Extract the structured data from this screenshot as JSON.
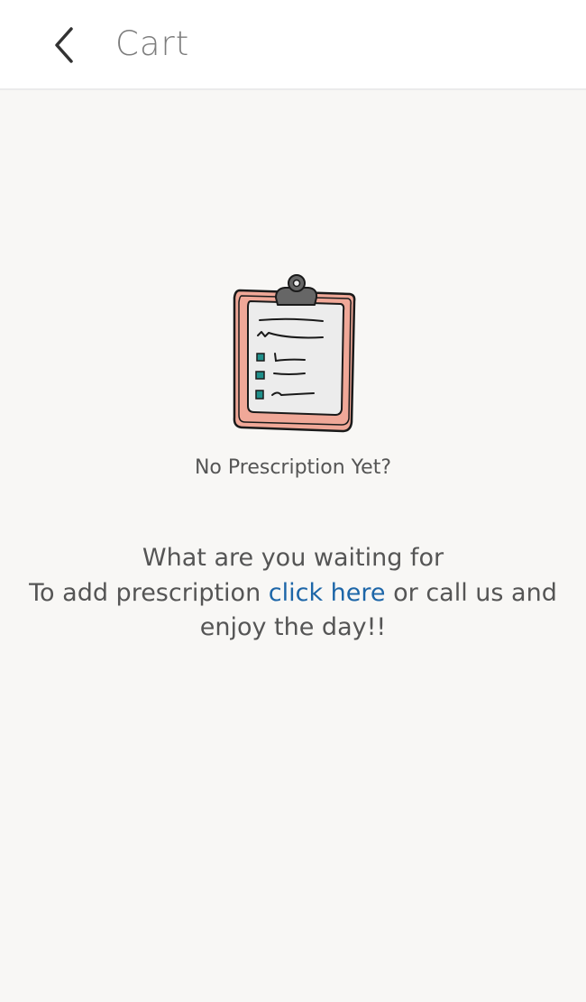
{
  "header": {
    "title": "Cart",
    "back_icon": "chevron-left-icon"
  },
  "empty_state": {
    "icon": "clipboard-icon",
    "caption": "No Prescription Yet?",
    "line1": "What are you waiting for",
    "line2_prefix": "To add prescription ",
    "link_text": "click here",
    "line2_suffix": " or call us and enjoy the day!!"
  },
  "colors": {
    "link": "#1d66a8",
    "text": "#555555",
    "title": "#7d7d7d",
    "background": "#f8f7f5",
    "clipboard_board": "#f0a898",
    "clipboard_paper": "#ececec",
    "checkbox": "#1f8f8a"
  }
}
